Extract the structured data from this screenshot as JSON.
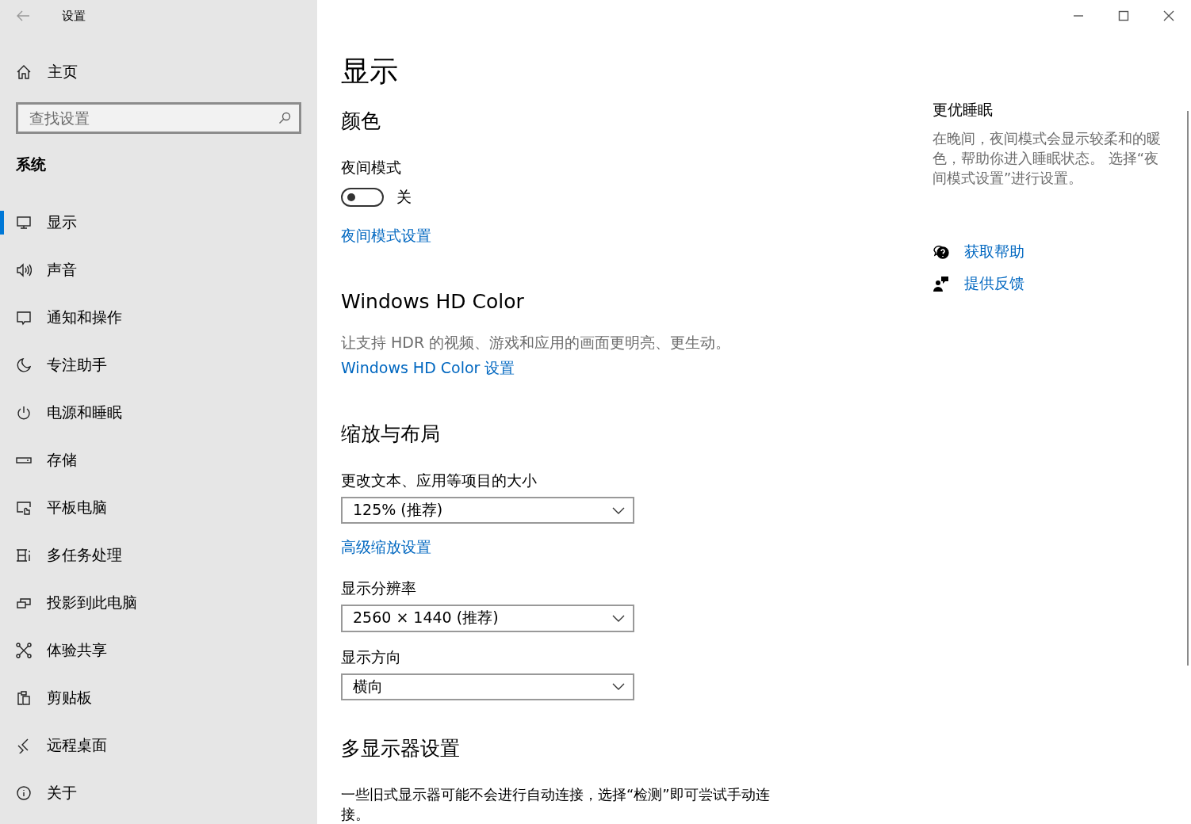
{
  "window": {
    "title": "设置"
  },
  "sidebar": {
    "home": "主页",
    "search": {
      "placeholder": "查找设置"
    },
    "section": "系统",
    "items": [
      {
        "label": "显示",
        "selected": true
      },
      {
        "label": "声音",
        "selected": false
      },
      {
        "label": "通知和操作",
        "selected": false
      },
      {
        "label": "专注助手",
        "selected": false
      },
      {
        "label": "电源和睡眠",
        "selected": false
      },
      {
        "label": "存储",
        "selected": false
      },
      {
        "label": "平板电脑",
        "selected": false
      },
      {
        "label": "多任务处理",
        "selected": false
      },
      {
        "label": "投影到此电脑",
        "selected": false
      },
      {
        "label": "体验共享",
        "selected": false
      },
      {
        "label": "剪贴板",
        "selected": false
      },
      {
        "label": "远程桌面",
        "selected": false
      },
      {
        "label": "关于",
        "selected": false
      }
    ]
  },
  "content": [
    {
      "kind": "title",
      "text": "显示"
    },
    {
      "kind": "heading",
      "text": "颜色"
    },
    {
      "kind": "label",
      "text": "夜间模式"
    },
    {
      "kind": "toggle",
      "on": false,
      "state_text": "关"
    },
    {
      "kind": "link",
      "text": "夜间模式设置"
    },
    {
      "kind": "heading",
      "text": "Windows HD Color"
    },
    {
      "kind": "note",
      "text": "让支持 HDR 的视频、游戏和应用的画面更明亮、更生动。"
    },
    {
      "kind": "link",
      "text": "Windows HD Color 设置"
    },
    {
      "kind": "heading",
      "text": "缩放与布局"
    },
    {
      "kind": "label",
      "text": "更改文本、应用等项目的大小"
    },
    {
      "kind": "dropdown",
      "value": "125% (推荐)"
    },
    {
      "kind": "link",
      "text": "高级缩放设置"
    },
    {
      "kind": "label",
      "text": "显示分辨率"
    },
    {
      "kind": "dropdown",
      "value": "2560 × 1440 (推荐)"
    },
    {
      "kind": "label",
      "text": "显示方向"
    },
    {
      "kind": "dropdown",
      "value": "横向"
    },
    {
      "kind": "heading",
      "text": "多显示器设置"
    },
    {
      "kind": "para",
      "text": "一些旧式显示器可能不会进行自动连接，选择“检测”即可尝试手动连接。"
    }
  ],
  "aside": {
    "title": "更优睡眠",
    "text": "在晚间，夜间模式会显示较柔和的暖色，帮助你进入睡眠状态。 选择“夜间模式设置”进行设置。",
    "links": [
      {
        "kind": "help",
        "text": "获取帮助"
      },
      {
        "kind": "feedback",
        "text": "提供反馈"
      }
    ]
  }
}
